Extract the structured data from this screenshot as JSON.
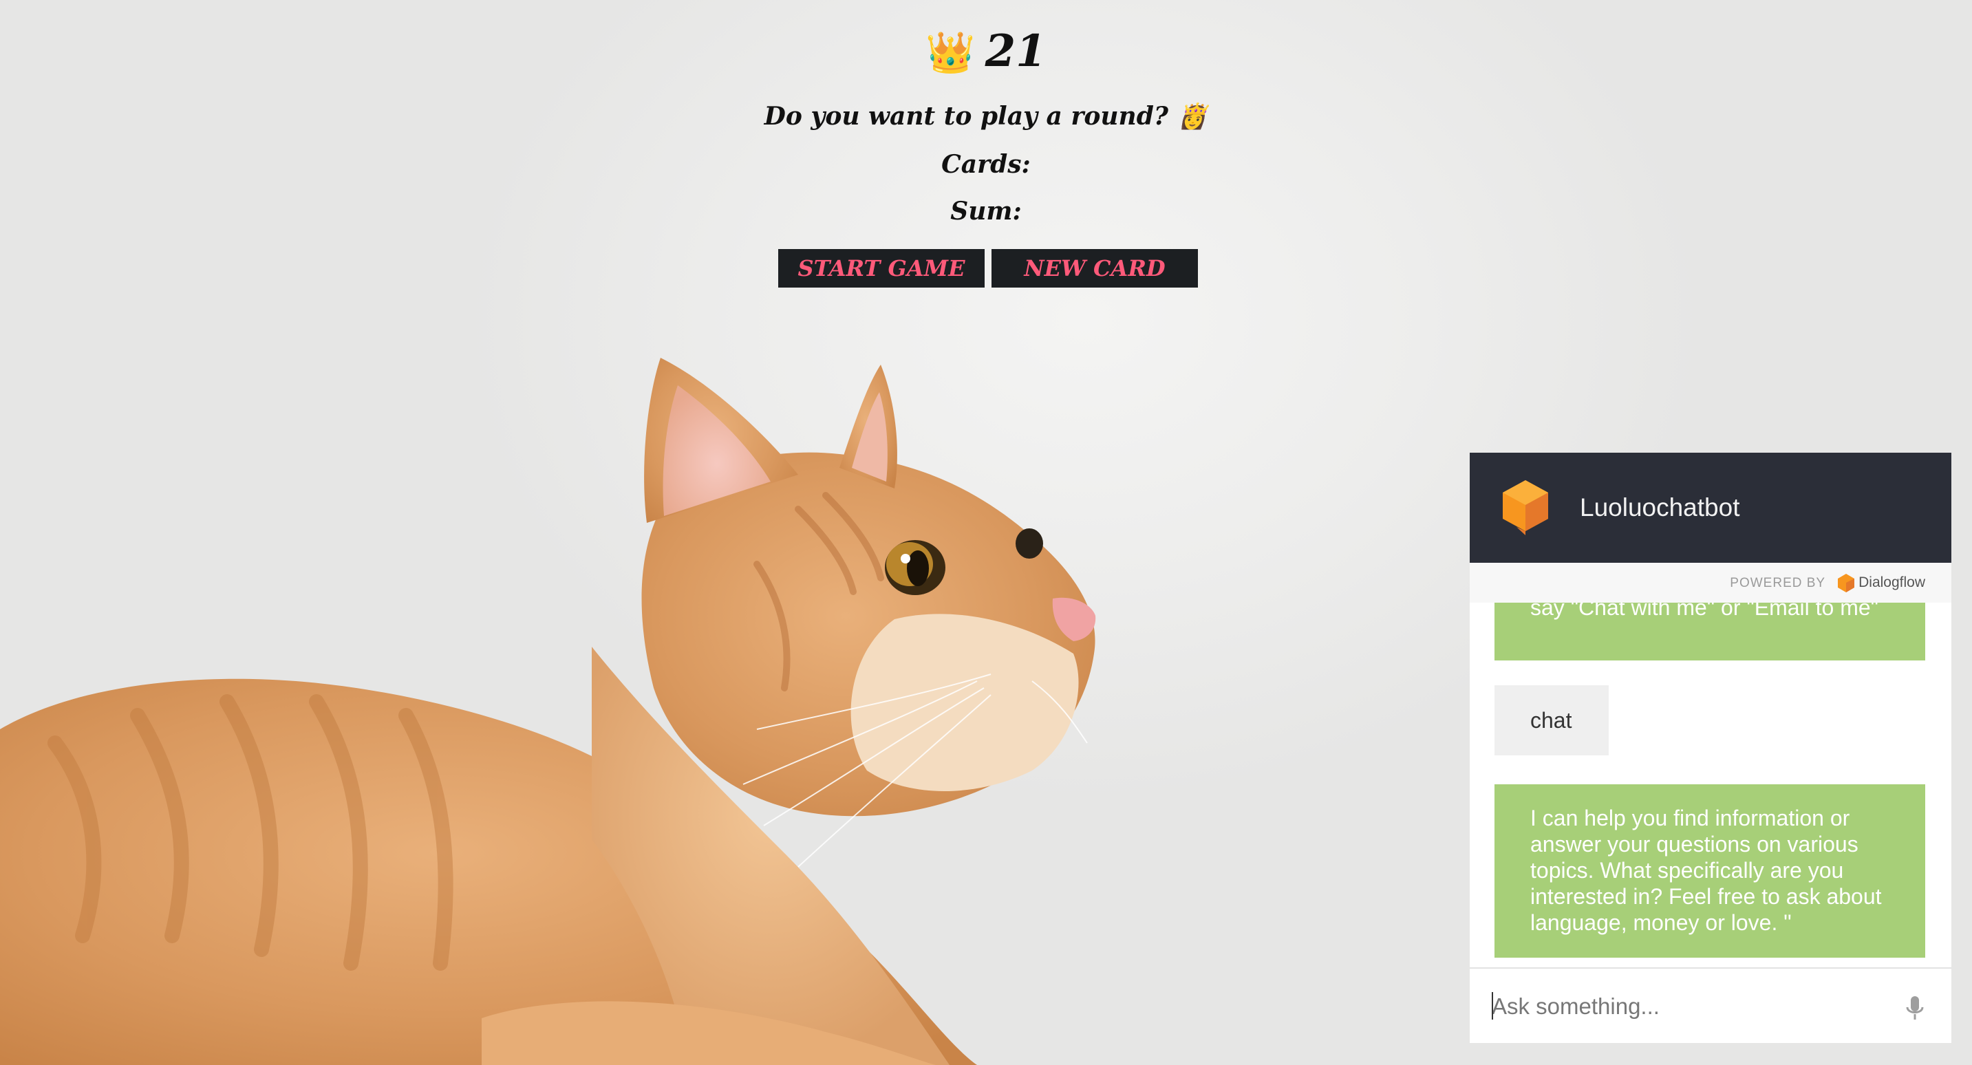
{
  "game": {
    "crown": "👑",
    "title": "21",
    "message": "Do you want to play a round? 👸",
    "cards_label": "Cards:",
    "sum_label": "Sum:",
    "start_button": "START GAME",
    "new_card_button": "NEW CARD"
  },
  "chat": {
    "bot_name": "Luoluochatbot",
    "powered_by_label": "POWERED BY",
    "powered_by_brand": "Dialogflow",
    "messages": [
      {
        "from": "bot",
        "text": "say \"Chat with me\" or \"Email to me\""
      },
      {
        "from": "user",
        "text": "chat"
      },
      {
        "from": "bot",
        "text": "I can help you find information or answer your questions on various topics. What specifically are you interested in? Feel free to ask about language, money or love. \""
      }
    ],
    "input_placeholder": "Ask something...",
    "colors": {
      "header": "#2b2e38",
      "bot_bubble": "#a7cf78",
      "user_bubble": "#efefef",
      "accent": "#f08a24"
    }
  },
  "colors": {
    "button_bg": "#1c1f22",
    "button_text": "#ff5a7a"
  }
}
